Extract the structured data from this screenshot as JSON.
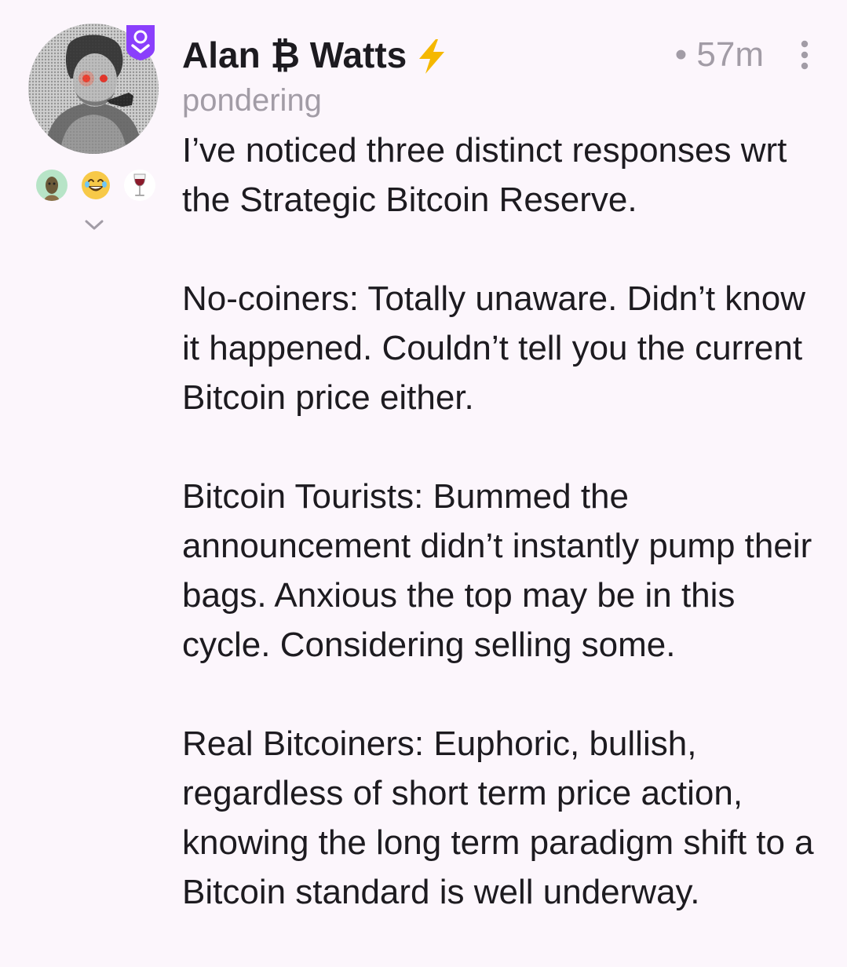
{
  "post": {
    "author": "Alan ₿ Watts",
    "status": "pondering",
    "time_ago": "• 57m",
    "paragraphs": [
      "I’ve noticed three distinct responses wrt the Strategic Bitcoin Reserve.",
      "No-coiners: Totally unaware. Didn’t know it happened. Couldn’t tell you the current Bitcoin price either.",
      "Bitcoin Tourists: Bummed the announcement didn’t instantly pump their bags. Anxious the top may be in this cycle. Considering selling some.",
      "Real Bitcoiners: Euphoric, bullish, regardless of short term price action, knowing the long term paradigm shift to a Bitcoin standard is well underway."
    ]
  },
  "icons": {
    "verified_badge": "shield-verified-icon",
    "zap": "lightning-bolt-icon",
    "more": "more-vertical-icon",
    "expand": "chevron-down-icon",
    "reactions": [
      "alien-icon",
      "laughing-face-icon",
      "wine-glass-icon"
    ]
  },
  "colors": {
    "background": "#fcf6fc",
    "text": "#1d1b20",
    "muted": "#a29ca6",
    "badge": "#8a3ffc",
    "zap": "#f5b800"
  }
}
